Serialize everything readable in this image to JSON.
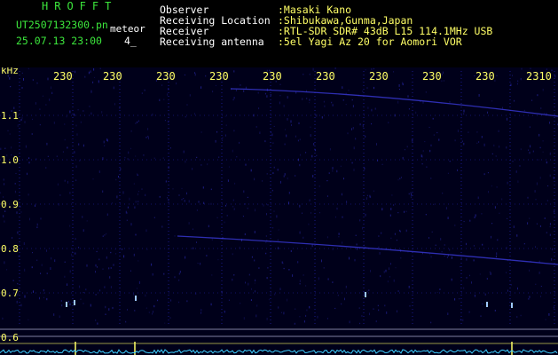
{
  "header": {
    "brand": "HROFFT",
    "filename": "UT2507132300.pn",
    "meteor_label": "meteor",
    "datetime": "25.07.13 23:00",
    "counter": "4_",
    "fields": [
      {
        "label": "Observer",
        "value": ":Masaki Kano"
      },
      {
        "label": "Receiving Location",
        "value": ":Shibukawa,Gunma,Japan"
      },
      {
        "label": "Receiver",
        "value": ":RTL-SDR SDR# 43dB L15 114.1MHz USB"
      },
      {
        "label": "Receiving antenna",
        "value": ":5el Yagi Az 20 for Aomori VOR"
      }
    ]
  },
  "spectrogram": {
    "y_unit": "kHz",
    "y_ticks": [
      "1.1",
      "1.0",
      "0.9",
      "0.8",
      "0.7",
      "0.6"
    ],
    "x_ticks": [
      "230",
      "230",
      "230",
      "230",
      "230",
      "230",
      "230",
      "230",
      "230",
      "2310"
    ],
    "colors": {
      "background": "#00001a",
      "grid": "#1a1a8a",
      "noise": "#2a2ab0",
      "axis_text": "#ffff66",
      "header_green": "#3ce63c",
      "baseline_signal": "#3fd0ff",
      "marker": "#ffff66"
    }
  }
}
